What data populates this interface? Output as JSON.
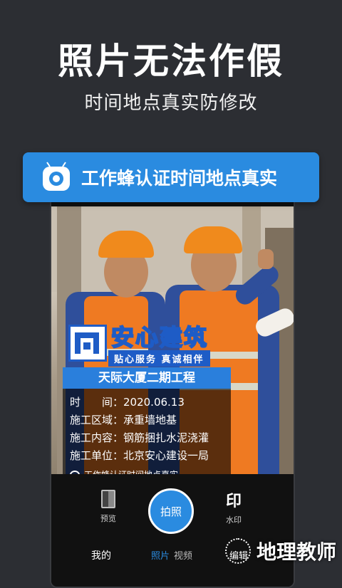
{
  "hero": {
    "title": "照片无法作假",
    "subtitle": "时间地点真实防修改"
  },
  "banner": {
    "text": "工作蜂认证时间地点真实"
  },
  "watermark": {
    "brand_name": "安心建筑",
    "brand_slogan": "贴心服务 真诚相伴",
    "project": "天际大厦二期工程",
    "rows": [
      "时　　间：2020.06.13",
      "施工区域：承重墙地基",
      "施工内容：钢筋捆扎水泥浇灌",
      "施工单位：北京安心建设一局"
    ],
    "footer": "工作蜂认证时间地点真实"
  },
  "controls": {
    "preview_label": "预览",
    "shutter_label": "拍照",
    "watermark_label": "水印",
    "watermark_icon_text": "印"
  },
  "tabs": {
    "mine": "我的",
    "photo": "照片",
    "video": "视频",
    "edit": "编辑"
  },
  "corner_watermark": "地理教师",
  "colors": {
    "background": "#2c2e33",
    "accent": "#2a8be0",
    "brand_blue": "#1e5cc6"
  }
}
